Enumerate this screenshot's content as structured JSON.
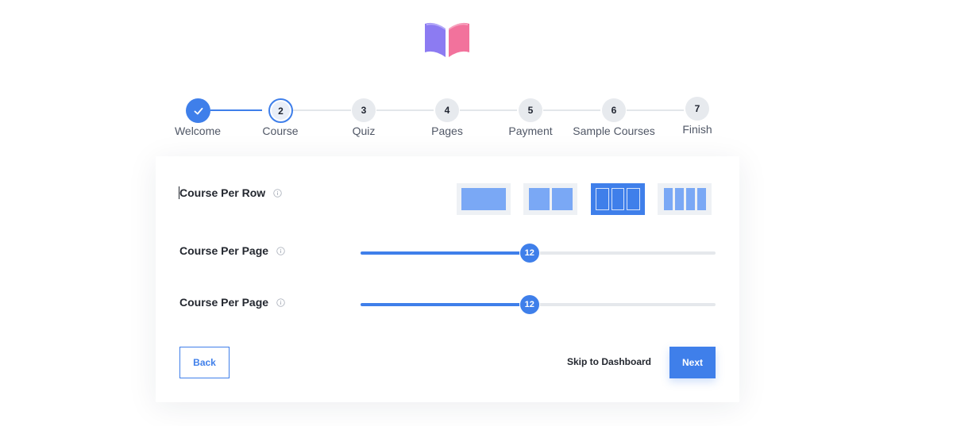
{
  "steps": [
    {
      "number": "",
      "label": "Welcome",
      "state": "done"
    },
    {
      "number": "2",
      "label": "Course",
      "state": "active"
    },
    {
      "number": "3",
      "label": "Quiz",
      "state": "pending"
    },
    {
      "number": "4",
      "label": "Pages",
      "state": "pending"
    },
    {
      "number": "5",
      "label": "Payment",
      "state": "pending"
    },
    {
      "number": "6",
      "label": "Sample Courses",
      "state": "pending"
    },
    {
      "number": "7",
      "label": "Finish",
      "state": "pending"
    }
  ],
  "settings": {
    "course_per_row": {
      "label": "Course Per Row",
      "options": [
        1,
        2,
        3,
        4
      ],
      "selected": 3
    },
    "course_per_page_1": {
      "label": "Course Per Page",
      "value": "12",
      "fill_fraction": 0.476
    },
    "course_per_page_2": {
      "label": "Course Per Page",
      "value": "12",
      "fill_fraction": 0.476
    }
  },
  "actions": {
    "back_label": "Back",
    "skip_label": "Skip to Dashboard",
    "next_label": "Next"
  },
  "colors": {
    "accent": "#3f7fea",
    "logo_left": "#8c7bf2",
    "logo_right": "#f2729c"
  }
}
